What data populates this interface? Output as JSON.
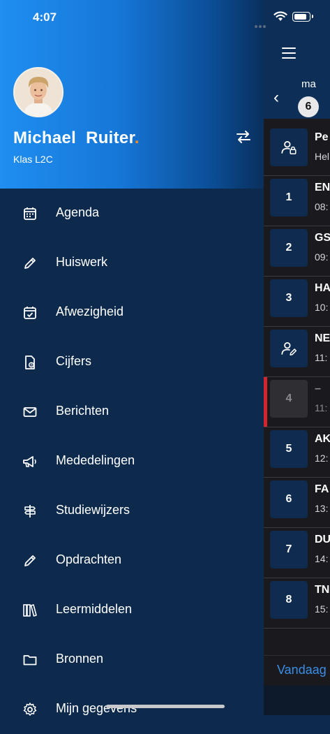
{
  "status_bar": {
    "time": "4:07"
  },
  "profile": {
    "first_name": "Michael",
    "last_name": "Ruiter",
    "dot": ".",
    "class": "Klas L2C"
  },
  "menu": [
    {
      "label": "Agenda",
      "icon": "calendar-icon"
    },
    {
      "label": "Huiswerk",
      "icon": "pencil-icon"
    },
    {
      "label": "Afwezigheid",
      "icon": "calendar-check-icon"
    },
    {
      "label": "Cijfers",
      "icon": "grade-document-icon"
    },
    {
      "label": "Berichten",
      "icon": "envelope-icon"
    },
    {
      "label": "Mededelingen",
      "icon": "megaphone-icon"
    },
    {
      "label": "Studiewijzers",
      "icon": "signpost-icon"
    },
    {
      "label": "Opdrachten",
      "icon": "pencil-icon"
    },
    {
      "label": "Leermiddelen",
      "icon": "books-icon"
    },
    {
      "label": "Bronnen",
      "icon": "folder-icon"
    },
    {
      "label": "Mijn gegevens",
      "icon": "gear-icon"
    }
  ],
  "agenda": {
    "day_name": "ma",
    "day_number": "6",
    "lessons": [
      {
        "box": "",
        "icon": "person-lock-icon",
        "subject": "Pe",
        "time": "Hel"
      },
      {
        "box": "1",
        "subject": "EN",
        "time": "08:"
      },
      {
        "box": "2",
        "subject": "GS",
        "time": "09:"
      },
      {
        "box": "3",
        "subject": "HA",
        "time": "10:"
      },
      {
        "box": "",
        "icon": "person-edit-icon",
        "subject": "NE",
        "time": "11:"
      },
      {
        "box": "4",
        "subject": "–",
        "time": "11:",
        "cancelled": true
      },
      {
        "box": "5",
        "subject": "AK",
        "time": "12:"
      },
      {
        "box": "6",
        "subject": "FA",
        "time": "13:"
      },
      {
        "box": "7",
        "subject": "DU",
        "time": "14:"
      },
      {
        "box": "8",
        "subject": "TN",
        "time": "15:"
      }
    ],
    "today_label": "Vandaag"
  },
  "colors": {
    "accent_orange": "#f28c1e",
    "cancel_red": "#d3262c",
    "link_blue": "#3a8ee6"
  }
}
